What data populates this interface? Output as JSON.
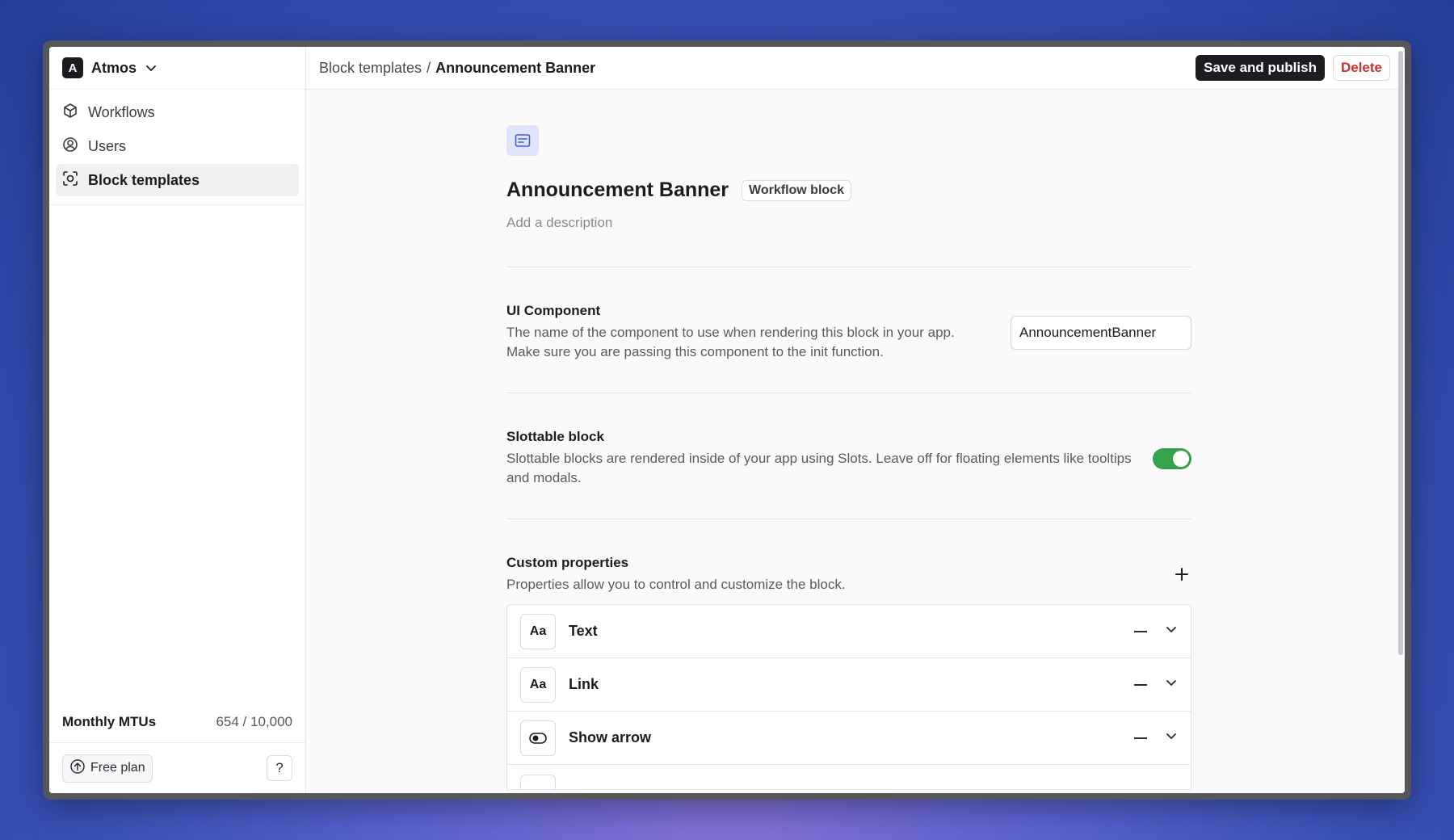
{
  "org": {
    "initial": "A",
    "name": "Atmos"
  },
  "sidebar": {
    "items": [
      {
        "label": "Workflows",
        "icon": "cube-icon"
      },
      {
        "label": "Users",
        "icon": "user-circle-icon"
      },
      {
        "label": "Block templates",
        "icon": "block-template-icon"
      }
    ],
    "mtu_label": "Monthly MTUs",
    "mtu_value": "654 / 10,000",
    "plan_label": "Free plan",
    "help_label": "?"
  },
  "header": {
    "breadcrumb_parent": "Block templates",
    "breadcrumb_separator": "/",
    "breadcrumb_current": "Announcement Banner",
    "save_label": "Save and publish",
    "delete_label": "Delete"
  },
  "block": {
    "title": "Announcement Banner",
    "badge": "Workflow block",
    "description_placeholder": "Add a description"
  },
  "ui_component": {
    "title": "UI Component",
    "description": "The name of the component to use when rendering this block in your app. Make sure you are passing this component to the init function.",
    "value": "AnnouncementBanner"
  },
  "slottable": {
    "title": "Slottable block",
    "description": "Slottable blocks are rendered inside of your app using Slots. Leave off for floating elements like tooltips and modals.",
    "enabled": true
  },
  "custom_properties": {
    "title": "Custom properties",
    "description": "Properties allow you to control and customize the block.",
    "items": [
      {
        "name": "Text",
        "icon_text": "Aa"
      },
      {
        "name": "Link",
        "icon_text": "Aa"
      },
      {
        "name": "Show arrow",
        "icon_text": ""
      }
    ]
  },
  "colors": {
    "accent": "#1c1d21",
    "danger": "#d0302b",
    "toggle_on": "#36a24c",
    "icon_bg": "#dfe4fb"
  }
}
